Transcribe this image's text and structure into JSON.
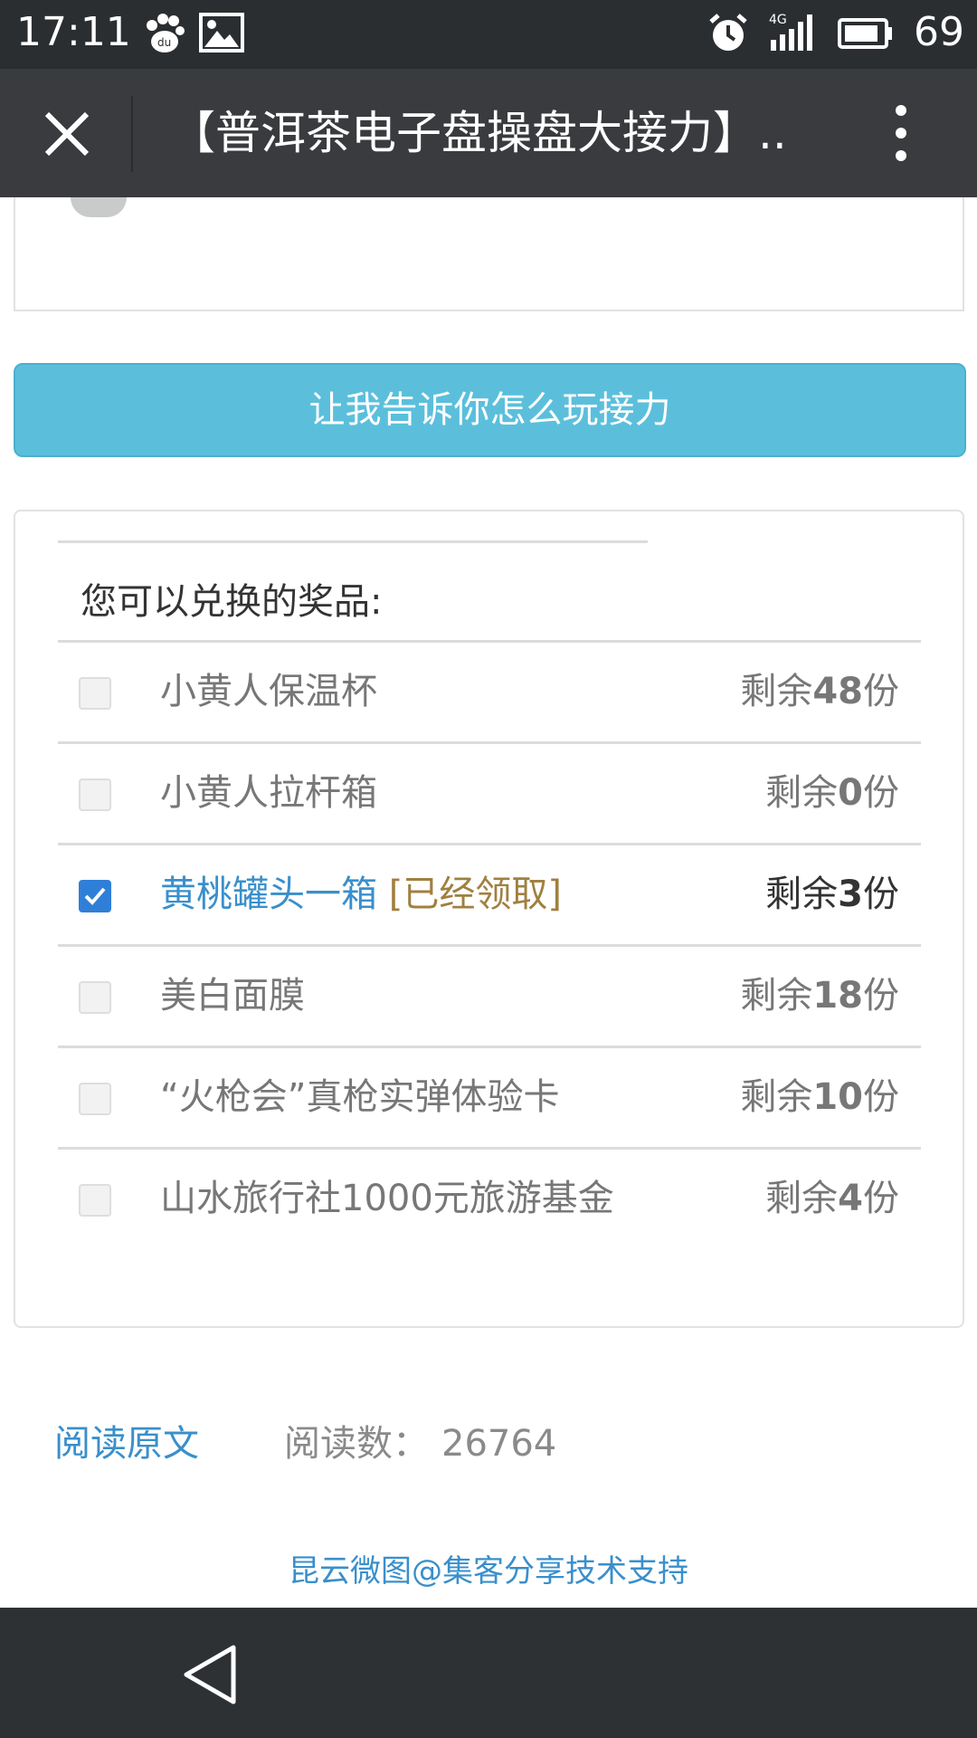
{
  "status_bar": {
    "time": "17:11",
    "battery": "69",
    "network": "4G",
    "icons": [
      "baidu-icon",
      "image-icon",
      "alarm-icon",
      "signal-icon",
      "battery-icon"
    ]
  },
  "title_bar": {
    "title": "【普洱茶电子盘操盘大接力】..",
    "close_icon": "close-icon",
    "more_icon": "more-vertical-icon"
  },
  "play_button": {
    "label": "让我告诉你怎么玩接力"
  },
  "prizes": {
    "heading": "您可以兑换的奖品:",
    "items": [
      {
        "name": "小黄人保温杯",
        "stock_prefix": "剩余",
        "stock_count": "48",
        "stock_suffix": "份",
        "checked": false,
        "claimed": ""
      },
      {
        "name": "小黄人拉杆箱",
        "stock_prefix": "剩余",
        "stock_count": "0",
        "stock_suffix": "份",
        "checked": false,
        "claimed": ""
      },
      {
        "name": "黄桃罐头一箱",
        "stock_prefix": "剩余",
        "stock_count": "3",
        "stock_suffix": "份",
        "checked": true,
        "claimed": "[已经领取]"
      },
      {
        "name": "美白面膜",
        "stock_prefix": "剩余",
        "stock_count": "18",
        "stock_suffix": "份",
        "checked": false,
        "claimed": ""
      },
      {
        "name": "“火枪会”真枪实弹体验卡",
        "stock_prefix": "剩余",
        "stock_count": "10",
        "stock_suffix": "份",
        "checked": false,
        "claimed": ""
      },
      {
        "name": "山水旅行社1000元旅游基金",
        "stock_prefix": "剩余",
        "stock_count": "4",
        "stock_suffix": "份",
        "checked": false,
        "claimed": ""
      }
    ]
  },
  "footer": {
    "read_original": "阅读原文",
    "read_count_label": "阅读数：",
    "read_count": "26764",
    "tech_support": "昆云微图@集客分享技术支持"
  },
  "nav_bar": {
    "back_icon": "back-triangle-icon"
  },
  "colors": {
    "accent": "#5bbfdc",
    "link": "#3a8fcb",
    "checked": "#2f7fd8",
    "claimed": "#a08040"
  }
}
